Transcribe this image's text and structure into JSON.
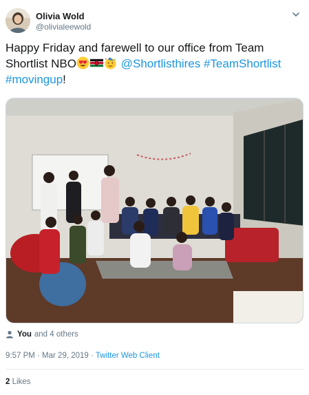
{
  "user": {
    "name": "Olivia Wold",
    "handle": "@olivialeewold"
  },
  "tweet": {
    "text_line1": "Happy Friday and farewell to our office from Team",
    "text_line2_prefix": "Shortlist NBO",
    "mention": "@Shortlisthires",
    "hashtag1": "#TeamShortlist",
    "hashtag2": "#movingup",
    "trailing": "!",
    "emojis": [
      "heart-eyes-emoji",
      "kenya-flag-emoji",
      "party-face-emoji"
    ]
  },
  "likers": {
    "you": "You",
    "others": "and 4 others"
  },
  "meta": {
    "timestamp": "9:57 PM · Mar 29, 2019 · ",
    "source": "Twitter Web Client"
  },
  "stats": {
    "likes_count": "2",
    "likes_label": "Likes"
  },
  "colors": {
    "link": "#1b95e0",
    "secondary": "#657786",
    "primary": "#14171a"
  },
  "icons": [
    "chevron-down-icon",
    "person-icon"
  ]
}
